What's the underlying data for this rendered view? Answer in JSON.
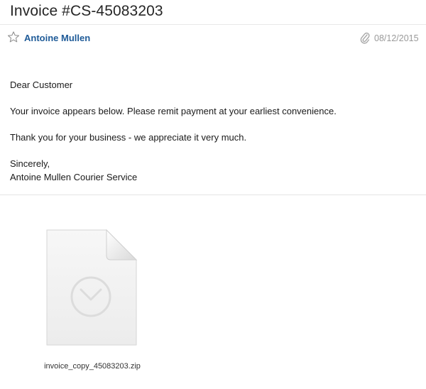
{
  "message": {
    "subject": "Invoice #CS-45083203",
    "sender": "Antoine Mullen",
    "date": "08/12/2015",
    "icons": {
      "star": "star-outline-icon",
      "attachment": "paperclip-icon"
    }
  },
  "body": {
    "greeting": "Dear Customer",
    "line1": "Your invoice appears below. Please remit payment at your earliest convenience.",
    "line2": "Thank you for your business - we appreciate it very much.",
    "closing": "Sincerely,",
    "signature": "Antoine Mullen Courier Service"
  },
  "attachment": {
    "filename": "invoice_copy_45083203.zip",
    "icon": "archive-file-icon"
  },
  "colors": {
    "sender_link": "#1f5b98",
    "date_text": "#9a9a9a"
  }
}
